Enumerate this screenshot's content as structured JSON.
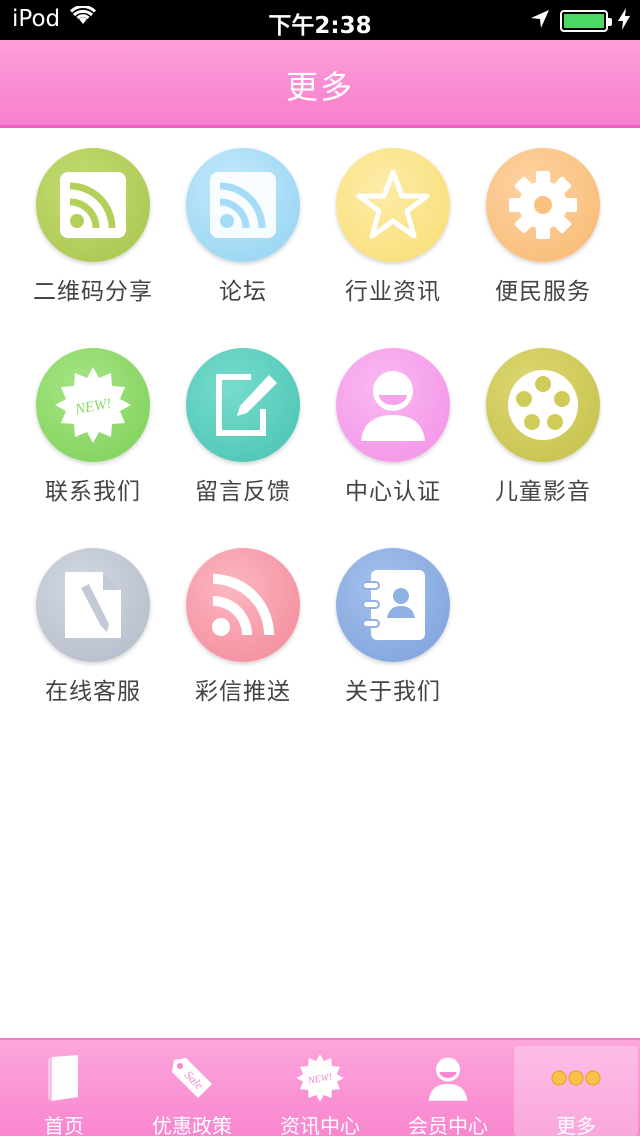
{
  "status_bar": {
    "carrier": "iPod",
    "time": "下午2:38"
  },
  "nav": {
    "title": "更多"
  },
  "grid": {
    "items": [
      {
        "label": "二维码分享",
        "icon": "rss-icon",
        "color": "#b3d05a"
      },
      {
        "label": "论坛",
        "icon": "rss-icon",
        "color": "#a6dcf5"
      },
      {
        "label": "行业资讯",
        "icon": "star-icon",
        "color": "#fbe48a"
      },
      {
        "label": "便民服务",
        "icon": "gear-icon",
        "color": "#fbc68a"
      },
      {
        "label": "联系我们",
        "icon": "new-badge-icon",
        "color": "#8fdb6a"
      },
      {
        "label": "留言反馈",
        "icon": "edit-icon",
        "color": "#5ccfbf"
      },
      {
        "label": "中心认证",
        "icon": "user-icon",
        "color": "#f7a3ec"
      },
      {
        "label": "儿童影音",
        "icon": "film-reel-icon",
        "color": "#d0cc5a"
      },
      {
        "label": "在线客服",
        "icon": "document-edit-icon",
        "color": "#c3cad6"
      },
      {
        "label": "彩信推送",
        "icon": "rss-icon",
        "color": "#f7a0ad"
      },
      {
        "label": "关于我们",
        "icon": "contacts-book-icon",
        "color": "#8fb1e4"
      }
    ]
  },
  "tabbar": {
    "items": [
      {
        "label": "首页",
        "icon": "book-icon"
      },
      {
        "label": "优惠政策",
        "icon": "sale-tag-icon"
      },
      {
        "label": "资讯中心",
        "icon": "new-badge-icon"
      },
      {
        "label": "会员中心",
        "icon": "user-icon"
      },
      {
        "label": "更多",
        "icon": "more-dots-icon",
        "active": true
      }
    ]
  }
}
